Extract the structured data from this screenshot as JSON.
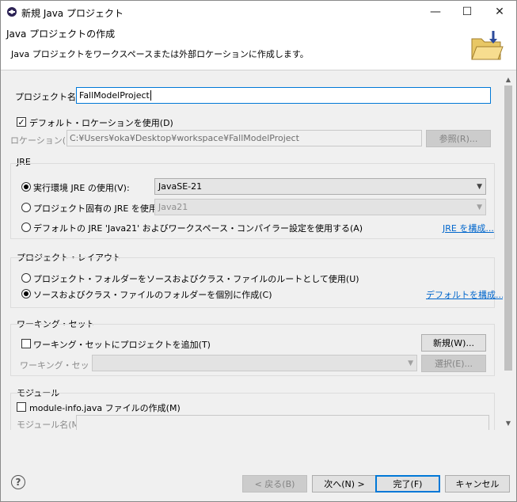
{
  "window": {
    "title": "新規 Java プロジェクト",
    "controls": {
      "minimize": "—",
      "maximize": "☐",
      "close": "✕"
    }
  },
  "banner": {
    "title": "Java プロジェクトの作成",
    "description": "Java プロジェクトをワークスペースまたは外部ロケーションに作成します。",
    "icon": "folder-icon"
  },
  "project_name": {
    "label": "プロジェクト名(P):",
    "value": "FallModelProject"
  },
  "location": {
    "default_checkbox": {
      "label": "デフォルト・ロケーションを使用(D)",
      "checked": true
    },
    "label": "ロケーション(L):",
    "value": "C:¥Users¥oka¥Desktop¥workspace¥FallModelProject",
    "browse_label": "参照(R)..."
  },
  "jre": {
    "group_title": "JRE",
    "options": [
      {
        "label": "実行環境 JRE の使用(V):",
        "selected": true,
        "combo": "JavaSE-21"
      },
      {
        "label": "プロジェクト固有の JRE を使用(S):",
        "selected": false,
        "combo": "Java21"
      },
      {
        "label": "デフォルトの JRE 'Java21' およびワークスペース・コンパイラー設定を使用する(A)",
        "selected": false
      }
    ],
    "configure_link": "JRE を構成..."
  },
  "layout": {
    "group_title": "プロジェクト・レイアウト",
    "options": [
      {
        "label": "プロジェクト・フォルダーをソースおよびクラス・ファイルのルートとして使用(U)",
        "selected": false
      },
      {
        "label": "ソースおよびクラス・ファイルのフォルダーを個別に作成(C)",
        "selected": true
      }
    ],
    "configure_link": "デフォルトを構成..."
  },
  "working_sets": {
    "group_title": "ワーキング・セット",
    "checkbox": {
      "label": "ワーキング・セットにプロジェクトを追加(T)",
      "checked": false
    },
    "new_button": "新規(W)...",
    "label": "ワーキング・セット(O):",
    "select_button": "選択(E)..."
  },
  "module": {
    "group_title": "モジュール",
    "checkbox": {
      "label": "module-info.java ファイルの作成(M)",
      "checked": false
    },
    "name_label": "モジュール名(M):"
  },
  "footer": {
    "back": "< 戻る(B)",
    "next": "次へ(N) >",
    "finish": "完了(F)",
    "cancel": "キャンセル"
  },
  "colors": {
    "accent": "#0078d7",
    "link": "#0066cc"
  }
}
